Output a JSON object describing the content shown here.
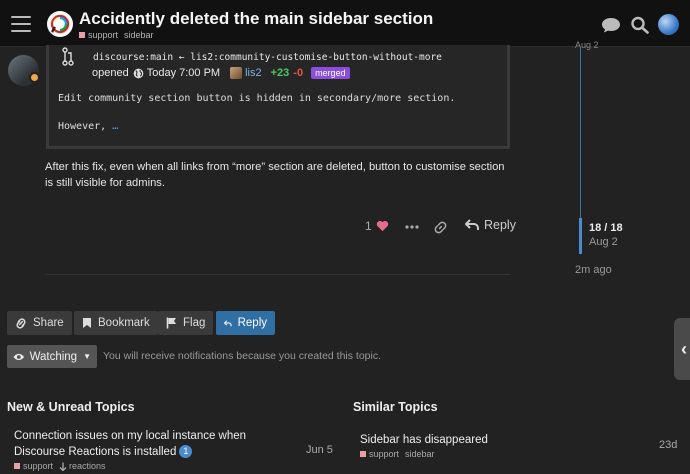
{
  "header": {
    "title": "Accidently deleted the main sidebar section",
    "category": "support",
    "tag": "sidebar"
  },
  "onebox": {
    "branch_line": "discourse:main ← lis2:community-customise-button-without-more",
    "opened_label": "opened",
    "opened_time": "Today 7:00 PM",
    "author": "lis2",
    "additions": "+23",
    "deletions": "-0",
    "status": "merged",
    "description": "Edit community section button is hidden in secondary/more section.",
    "however": "However,",
    "more": "…"
  },
  "post": {
    "text": "After this fix, even when all links from “more” section are deleted, button to customise section is still visible for admins.",
    "like_count": "1",
    "reply_label": "Reply"
  },
  "timeline": {
    "top_label": "Aug 2",
    "position": "18 / 18",
    "date": "Aug 2",
    "ago": "2m ago"
  },
  "footer_buttons": {
    "share": "Share",
    "bookmark": "Bookmark",
    "flag": "Flag",
    "reply": "Reply"
  },
  "notifications": {
    "level": "Watching",
    "text": "You will receive notifications because you created this topic."
  },
  "new_unread": {
    "title": "New & Unread Topics",
    "topics": [
      {
        "title_line1": "Connection issues on my local instance when",
        "title_line2": "Discourse Reactions is installed",
        "badge": "1",
        "category": "support",
        "tag": "reactions",
        "date": "Jun 5"
      }
    ]
  },
  "similar": {
    "title": "Similar Topics",
    "topics": [
      {
        "title": "Sidebar has disappeared",
        "category": "support",
        "tag": "sidebar",
        "date": "23d"
      }
    ]
  },
  "colors": {
    "accent": "#2f6fa3",
    "merged": "#8b4ddb",
    "additions": "#4fc56a",
    "deletions": "#e5534b",
    "category_support": "#e8a0a4"
  }
}
